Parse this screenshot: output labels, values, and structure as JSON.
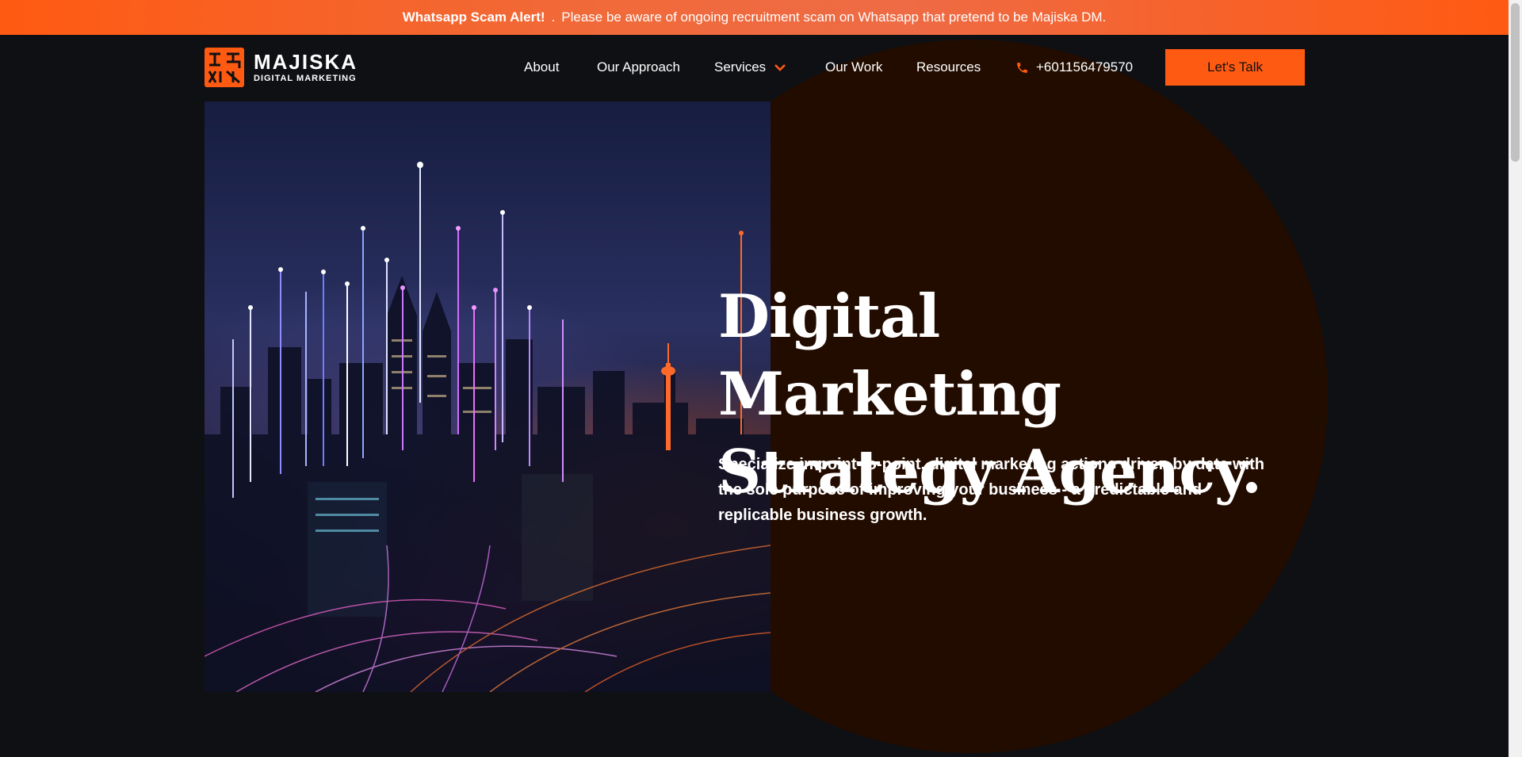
{
  "alert": {
    "title": "Whatsapp Scam Alert!",
    "separator": ".",
    "message": "Please be aware of ongoing recruitment scam on Whatsapp that pretend to be Majiska DM."
  },
  "logo": {
    "name": "MAJISKA",
    "tagline": "DIGITAL MARKETING"
  },
  "nav": {
    "about": "About",
    "approach": "Our Approach",
    "services": "Services",
    "work": "Our Work",
    "resources": "Resources",
    "phone": "+601156479570",
    "cta": "Let's Talk"
  },
  "hero": {
    "headline_line1": "Digital Marketing",
    "headline_line2": "Strategy Agency.",
    "subtitle": "Specialize in point-to-point, digital marketing actions driven by data with the sole purpose of improving your business - a predictable and replicable business growth."
  },
  "colors": {
    "accent": "#ff5a12",
    "background": "#0e1014",
    "circle": "#220c00"
  },
  "icons": {
    "services_dropdown": "chevron-down-icon",
    "phone": "phone-icon"
  }
}
